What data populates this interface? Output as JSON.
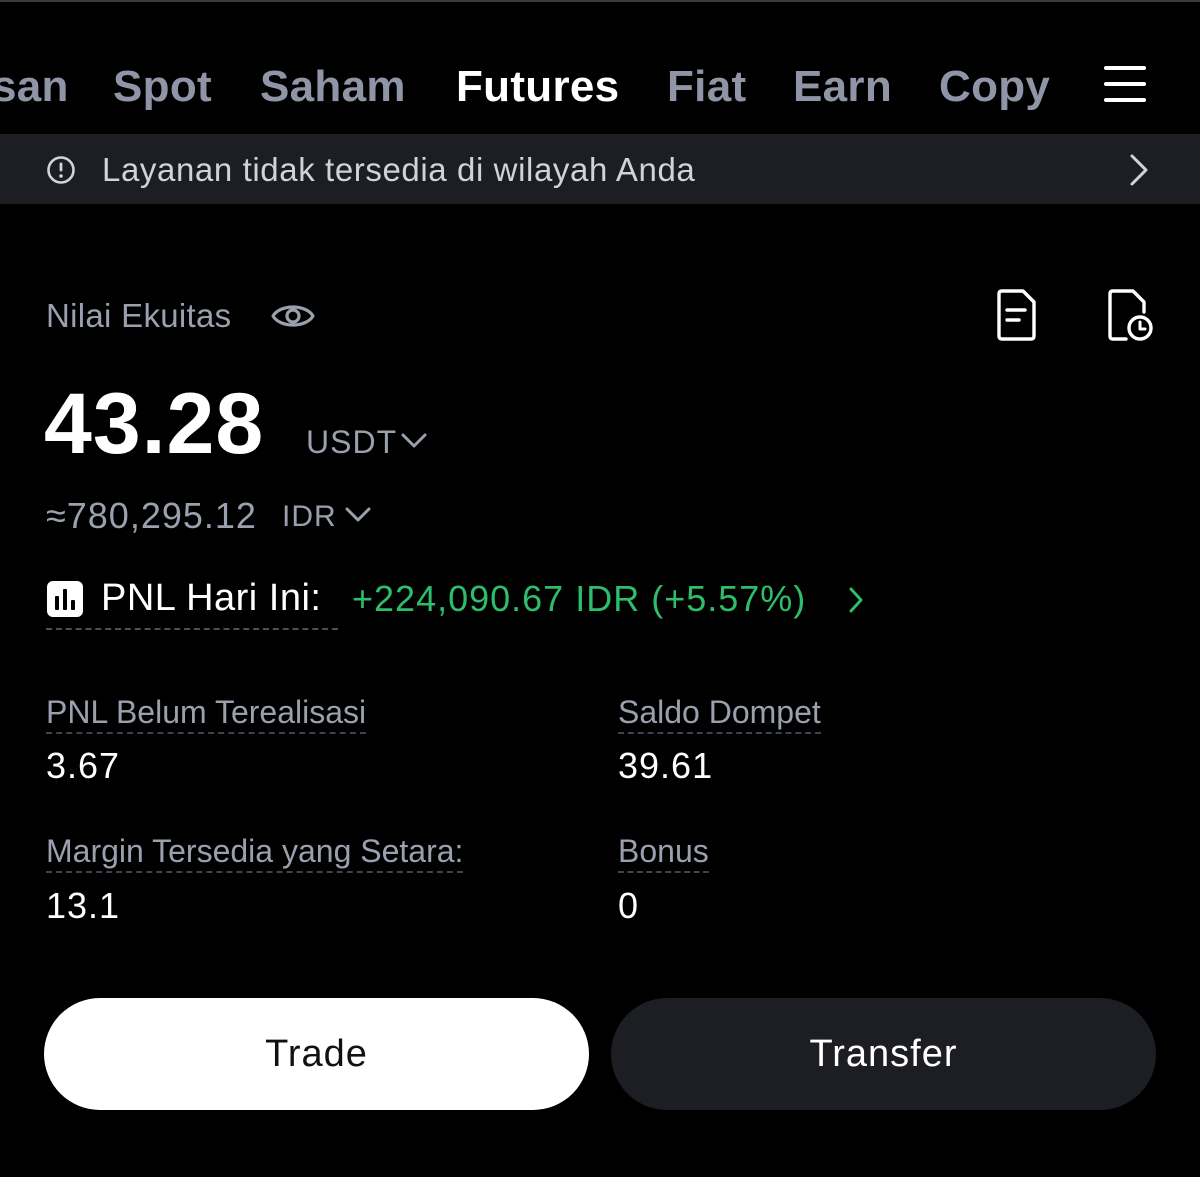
{
  "nav": {
    "tabs": [
      {
        "label": "san",
        "active": false
      },
      {
        "label": "Spot",
        "active": false
      },
      {
        "label": "Saham",
        "active": false
      },
      {
        "label": "Futures",
        "active": true
      },
      {
        "label": "Fiat",
        "active": false
      },
      {
        "label": "Earn",
        "active": false
      },
      {
        "label": "Copy",
        "active": false
      }
    ],
    "menu_icon": "hamburger-menu-icon"
  },
  "banner": {
    "icon": "info-circle-icon",
    "text": "Layanan tidak tersedia di wilayah Anda",
    "chevron": "chevron-right-icon"
  },
  "equity": {
    "label": "Nilai Ekuitas",
    "value": "43.28",
    "unit": "USDT",
    "approx_value": "≈780,295.12",
    "approx_unit": "IDR",
    "icons": [
      "eye-icon",
      "document-icon",
      "history-icon"
    ]
  },
  "pnl_today": {
    "label": "PNL Hari Ini:",
    "value": "+224,090.67 IDR (+5.57%)",
    "color": "#2ebd6b"
  },
  "stats": [
    {
      "label": "PNL Belum Terealisasi",
      "value": "3.67"
    },
    {
      "label": "Saldo Dompet",
      "value": "39.61"
    },
    {
      "label": "Margin Tersedia yang Setara:",
      "value": "13.1"
    },
    {
      "label": "Bonus",
      "value": "0"
    }
  ],
  "actions": {
    "trade_label": "Trade",
    "transfer_label": "Transfer"
  },
  "colors": {
    "background": "#000000",
    "banner": "#1c1e24",
    "muted_text": "#9aa0ad",
    "positive": "#2ebd6b"
  }
}
